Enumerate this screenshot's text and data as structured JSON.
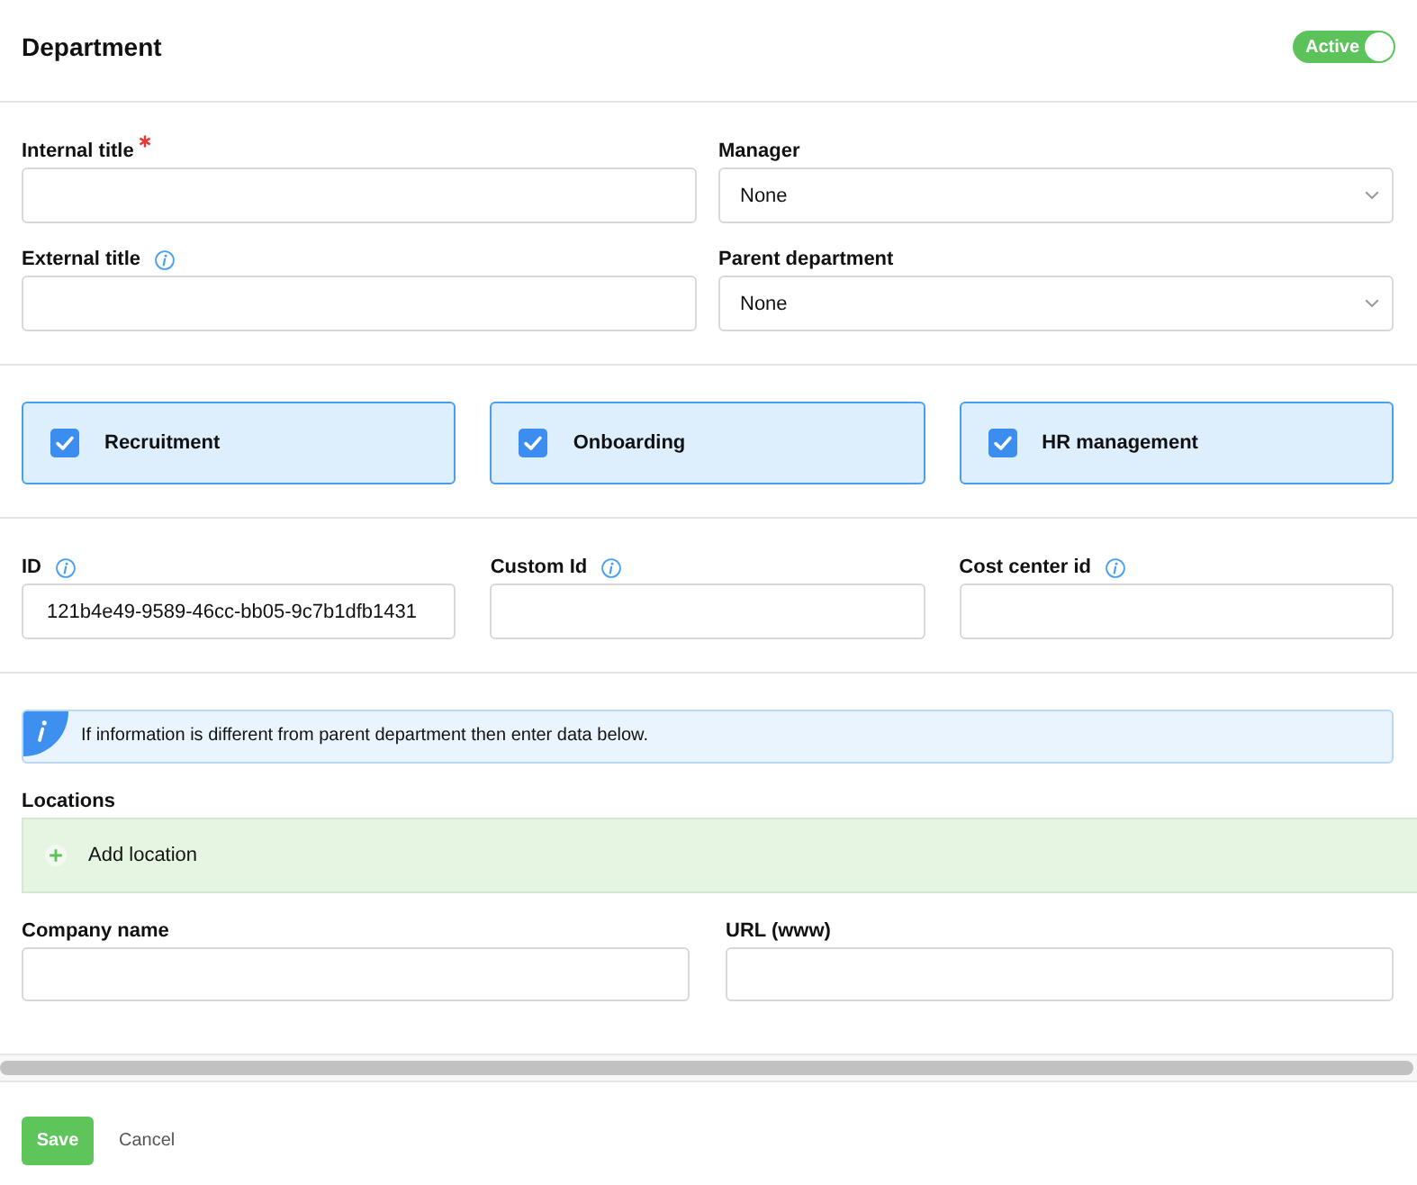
{
  "header": {
    "title": "Department",
    "status_toggle": {
      "label": "Active",
      "on": true
    }
  },
  "general_fields": [
    {
      "label": "Internal title",
      "kind": "text",
      "required": true,
      "info": false
    },
    {
      "label": "Manager",
      "kind": "select",
      "value": "None",
      "required": false,
      "info": false
    },
    {
      "label": "External title",
      "kind": "text",
      "required": false,
      "info": true
    },
    {
      "label": "Parent department",
      "kind": "select",
      "value": "None",
      "required": false,
      "info": false
    }
  ],
  "modules": [
    {
      "label": "Recruitment",
      "checked": true
    },
    {
      "label": "Onboarding",
      "checked": true
    },
    {
      "label": "HR management",
      "checked": true
    }
  ],
  "id_fields": [
    {
      "label": "ID",
      "info": true,
      "value": "121b4e49-9589-46cc-bb05-9c7b1dfb1431"
    },
    {
      "label": "Custom Id",
      "info": true
    },
    {
      "label": "Cost center id",
      "info": true
    }
  ],
  "notice": {
    "text": "If information is different from parent department then enter data below."
  },
  "locations": {
    "label": "Locations",
    "add_button": "Add location"
  },
  "company_fields": [
    {
      "label": "Company name"
    },
    {
      "label": "URL (www)"
    }
  ],
  "actions": {
    "save": "Save",
    "cancel": "Cancel"
  }
}
